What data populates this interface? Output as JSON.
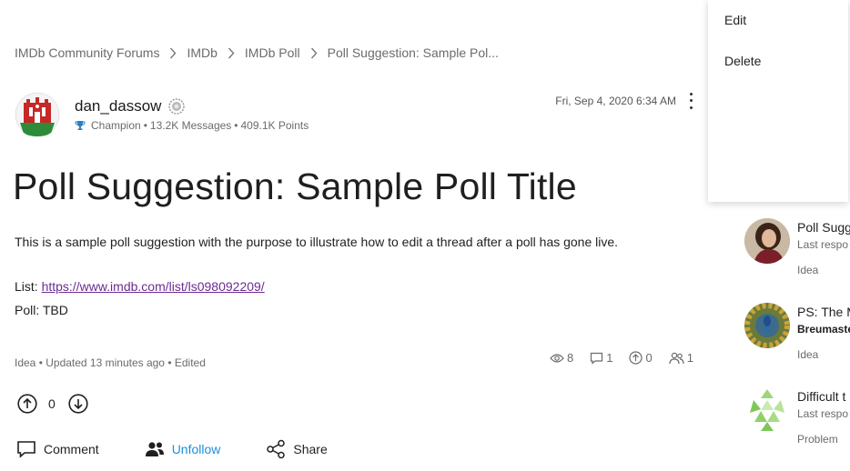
{
  "breadcrumb": [
    {
      "label": "IMDb Community Forums"
    },
    {
      "label": "IMDb"
    },
    {
      "label": "IMDb Poll"
    },
    {
      "label": "Poll Suggestion: Sample Pol..."
    }
  ],
  "author": {
    "name": "dan_dassow",
    "rank": "Champion",
    "messages": "13.2K Messages",
    "points": "409.1K Points",
    "sep": "•"
  },
  "post": {
    "date": "Fri, Sep 4, 2020 6:34 AM",
    "title": "Poll Suggestion: Sample Poll Title",
    "body_line1": "This is a sample poll suggestion with the purpose to illustrate how to edit a thread after a poll has gone live.",
    "list_label": "List: ",
    "list_url": "https://www.imdb.com/list/ls098092209/",
    "poll_line": "Poll: TBD",
    "footer": "Idea • Updated 13 minutes ago • Edited"
  },
  "stats": {
    "views": "8",
    "comments": "1",
    "votes": "0",
    "followers": "1"
  },
  "vote": {
    "count": "0"
  },
  "actions": {
    "comment": "Comment",
    "unfollow": "Unfollow",
    "share": "Share"
  },
  "menu": {
    "edit": "Edit",
    "delete": "Delete"
  },
  "sidebar": [
    {
      "title": "Poll Sugg",
      "sub": "Last respo",
      "category": "Idea"
    },
    {
      "title": "PS: The M",
      "sub": "Breumaste",
      "category": "Idea"
    },
    {
      "title": "Difficult t",
      "sub": "Last respo",
      "category": "Problem"
    }
  ],
  "colors": {
    "link": "#6b2c91",
    "accent": "#1e90d6"
  }
}
